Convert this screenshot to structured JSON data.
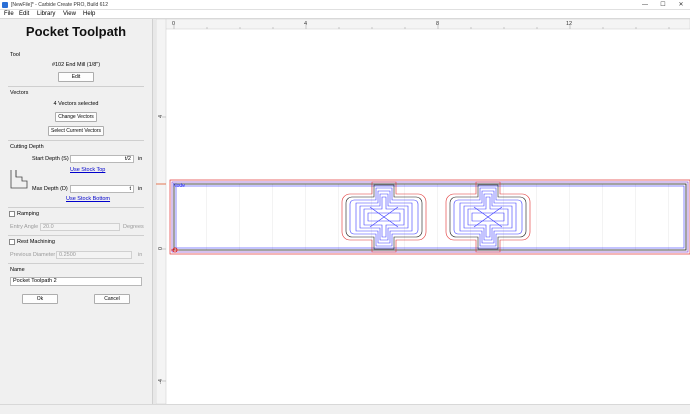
{
  "window": {
    "title": "[NewFile]* - Carbide Create PRO, Build 612",
    "min": "—",
    "max": "☐",
    "close": "✕"
  },
  "menu": [
    "File",
    "Edit",
    "Library",
    "View",
    "Help"
  ],
  "panel": {
    "heading": "Pocket Toolpath",
    "tool": {
      "section": "Tool",
      "name": "#102 End Mill (1/8\")",
      "edit": "Edit"
    },
    "vectors": {
      "section": "Vectors",
      "count": "4 Vectors selected",
      "change": "Change Vectors",
      "select": "Select Current Vectors"
    },
    "cutting": {
      "section": "Cutting Depth",
      "start_label": "Start Depth (S)",
      "start_value": "t/2",
      "start_unit": "in",
      "use_stock_top": "Use Stock Top",
      "max_label": "Max Depth (D)",
      "max_value": "t",
      "max_unit": "in",
      "use_stock_bottom": "Use Stock Bottom"
    },
    "ramping": {
      "label": "Ramping",
      "entry_label": "Entry Angle",
      "entry_value": "20.0",
      "entry_unit": "Degrees"
    },
    "rest": {
      "label": "Rest Machining",
      "prev_label": "Previous Diameter",
      "prev_value": "0.2500",
      "prev_unit": "in"
    },
    "name": {
      "section": "Name",
      "value": "Pocket Toolpath 2"
    },
    "ok": "Ok",
    "cancel": "Cancel"
  },
  "canvas": {
    "ruler_top": [
      "0",
      "4",
      "8",
      "12"
    ],
    "ruler_left": [
      "4",
      "0",
      "-4"
    ],
    "node_label": "Node",
    "colors": {
      "outline": "#1a1a1a",
      "toolpath_blue": "#3a3aff",
      "toolpath_red": "#e03030",
      "toolpath_purple": "#8a4bd0",
      "grid": "#d6d6d6",
      "origin": "#dd2222"
    }
  }
}
